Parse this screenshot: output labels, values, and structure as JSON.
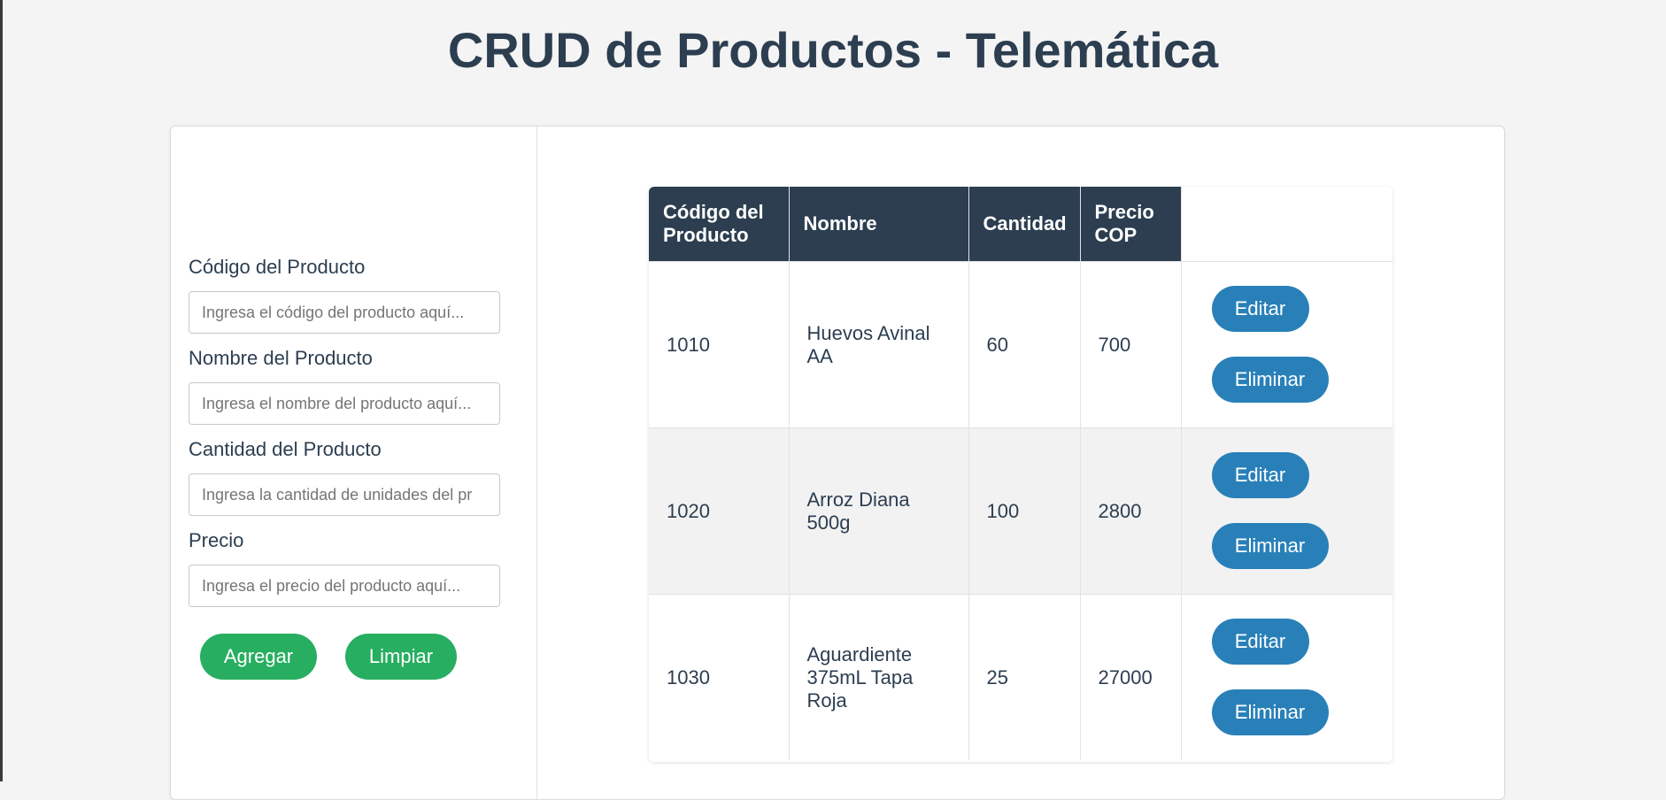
{
  "title": "CRUD de Productos - Telemática",
  "form": {
    "fields": [
      {
        "label": "Código del Producto",
        "placeholder": "Ingresa el código del producto aquí..."
      },
      {
        "label": "Nombre del Producto",
        "placeholder": "Ingresa el nombre del producto aquí..."
      },
      {
        "label": "Cantidad del Producto",
        "placeholder": "Ingresa la cantidad de unidades del pr"
      },
      {
        "label": "Precio",
        "placeholder": "Ingresa el precio del producto aquí..."
      }
    ],
    "add_label": "Agregar",
    "clear_label": "Limpiar"
  },
  "table": {
    "headers": [
      "Código del Producto",
      "Nombre",
      "Cantidad",
      "Precio COP"
    ],
    "rows": [
      {
        "codigo": "1010",
        "nombre": "Huevos Avinal AA",
        "cantidad": "60",
        "precio": "700"
      },
      {
        "codigo": "1020",
        "nombre": "Arroz Diana 500g",
        "cantidad": "100",
        "precio": "2800"
      },
      {
        "codigo": "1030",
        "nombre": "Aguardiente 375mL Tapa Roja",
        "cantidad": "25",
        "precio": "27000"
      }
    ],
    "edit_label": "Editar",
    "delete_label": "Eliminar"
  },
  "colors": {
    "heading": "#2c3e50",
    "green_button": "#27ae60",
    "blue_button": "#2980b9",
    "page_background": "#f4f4f4"
  }
}
